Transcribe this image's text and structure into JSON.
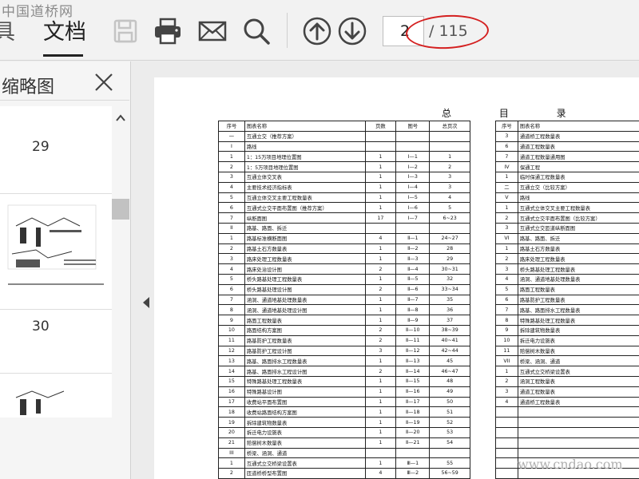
{
  "watermark_top": "中国道桥网",
  "watermark_bottom": "www.cndao.com",
  "tabs": [
    {
      "label": "具"
    },
    {
      "label": "文档"
    }
  ],
  "toolbar": {
    "icons": [
      "save-icon",
      "print-icon",
      "email-icon",
      "search-icon",
      "page-up-icon",
      "page-down-icon"
    ],
    "current_page": "2",
    "total_pages": "/ 115",
    "highlight_color": "#d42020"
  },
  "sidebar": {
    "title": "缩略图",
    "tools": [
      "delete-icon",
      "extract-icon",
      "rotate-icon"
    ],
    "thumbnails": [
      {
        "label": "29"
      },
      {
        "label": "30"
      }
    ]
  },
  "document": {
    "title": "总 目 录",
    "left_table": {
      "headers": [
        "序号",
        "图表名称",
        "页数",
        "图号",
        "总页次"
      ],
      "rows": [
        [
          "一",
          "互通立交（推荐方案）",
          "",
          "",
          ""
        ],
        [
          "I",
          "路线",
          "",
          "",
          ""
        ],
        [
          "1",
          "1：15万项目地理位置图",
          "1",
          "Ⅰ—1",
          "1"
        ],
        [
          "2",
          "1：5万项目地理位置图",
          "1",
          "Ⅰ—2",
          "2"
        ],
        [
          "3",
          "互通立体交叉表",
          "1",
          "Ⅰ—3",
          "3"
        ],
        [
          "4",
          "主要技术经济指标表",
          "1",
          "Ⅰ—4",
          "3"
        ],
        [
          "5",
          "互通立体交叉主要工程数量表",
          "1",
          "Ⅰ—5",
          "4"
        ],
        [
          "6",
          "互通式立交平面布置图（推荐方案）",
          "1",
          "Ⅰ—6",
          "5"
        ],
        [
          "7",
          "纵断面图",
          "17",
          "Ⅰ—7",
          "6~23"
        ],
        [
          "II",
          "路基、路面、拆迁",
          "",
          "",
          ""
        ],
        [
          "1",
          "路基标准横断面图",
          "4",
          "Ⅱ—1",
          "24~27"
        ],
        [
          "2",
          "路基土石方数量表",
          "1",
          "Ⅱ—2",
          "28"
        ],
        [
          "3",
          "路床处理工程数量表",
          "1",
          "Ⅱ—3",
          "29"
        ],
        [
          "4",
          "路床处治设计图",
          "2",
          "Ⅱ—4",
          "30~31"
        ],
        [
          "5",
          "桥头路基处理工程数量表",
          "1",
          "Ⅱ—5",
          "32"
        ],
        [
          "6",
          "桥头路基处理设计图",
          "2",
          "Ⅱ—6",
          "33~34"
        ],
        [
          "7",
          "涵洞、通道地基处理数量表",
          "1",
          "Ⅱ—7",
          "35"
        ],
        [
          "8",
          "涵洞、通道地基处理设计图",
          "1",
          "Ⅱ—8",
          "36"
        ],
        [
          "9",
          "路面工程数量表",
          "1",
          "Ⅱ—9",
          "37"
        ],
        [
          "10",
          "路面结构方案图",
          "2",
          "Ⅱ—10",
          "38~39"
        ],
        [
          "11",
          "路基防护工程数量表",
          "2",
          "Ⅱ—11",
          "40~41"
        ],
        [
          "12",
          "路基防护工程设计图",
          "3",
          "Ⅱ—12",
          "42~44"
        ],
        [
          "13",
          "路基、路面排水工程数量表",
          "1",
          "Ⅱ—13",
          "45"
        ],
        [
          "14",
          "路基、路面排水工程设计图",
          "2",
          "Ⅱ—14",
          "46~47"
        ],
        [
          "15",
          "特殊路基处理工程数量表",
          "1",
          "Ⅱ—15",
          "48"
        ],
        [
          "16",
          "特殊路基设计图",
          "1",
          "Ⅱ—16",
          "49"
        ],
        [
          "17",
          "收费站平面布置图",
          "1",
          "Ⅱ—17",
          "50"
        ],
        [
          "18",
          "收费站路面结构方案图",
          "1",
          "Ⅱ—18",
          "51"
        ],
        [
          "19",
          "拆除建筑物数量表",
          "1",
          "Ⅱ—19",
          "52"
        ],
        [
          "20",
          "拆迁电力设施表",
          "1",
          "Ⅱ—20",
          "53"
        ],
        [
          "21",
          "赔偿树木数量表",
          "1",
          "Ⅱ—21",
          "54"
        ],
        [
          "III",
          "桥梁、涵洞、通道",
          "",
          "",
          ""
        ],
        [
          "1",
          "互通式立交桥梁设置表",
          "1",
          "Ⅲ—1",
          "55"
        ],
        [
          "2",
          "匝道桥桥型布置图",
          "4",
          "Ⅲ—2",
          "56~59"
        ]
      ]
    },
    "right_table": {
      "headers": [
        "序号",
        "图表名称"
      ],
      "rows": [
        [
          "3",
          "通道桥工程数量表"
        ],
        [
          "6",
          "通道工程数量表"
        ],
        [
          "7",
          "通道工程数量通用图"
        ],
        [
          "IV",
          "保通工程"
        ],
        [
          "1",
          "临时保通工程数量表"
        ],
        [
          "二",
          "互通立交（比较方案）"
        ],
        [
          "V",
          "路线"
        ],
        [
          "1",
          "互通式立体交叉主要工程数量表"
        ],
        [
          "2",
          "互通式立交平面布置图（比较方案）"
        ],
        [
          "3",
          "互通式立交匝道纵断面图"
        ],
        [
          "VI",
          "路基、路面、拆迁"
        ],
        [
          "1",
          "路基土石方数量表"
        ],
        [
          "2",
          "路床处理工程数量表"
        ],
        [
          "3",
          "桥头路基处理工程数量表"
        ],
        [
          "4",
          "涵洞、通道地基处理数量表"
        ],
        [
          "5",
          "路面工程数量表"
        ],
        [
          "6",
          "路基防护工程数量表"
        ],
        [
          "7",
          "路基、路面排水工程数量表"
        ],
        [
          "8",
          "特殊路基处理工程数量表"
        ],
        [
          "9",
          "拆除建筑物数量表"
        ],
        [
          "10",
          "拆迁电力设施表"
        ],
        [
          "11",
          "赔偿树木数量表"
        ],
        [
          "VII",
          "桥梁、涵洞、通道"
        ],
        [
          "1",
          "互通式立交桥梁设置表"
        ],
        [
          "2",
          "涵洞工程数量表"
        ],
        [
          "3",
          "通道工程数量表"
        ],
        [
          "4",
          "通道桥工程数量表"
        ],
        [
          "",
          ""
        ],
        [
          "",
          ""
        ],
        [
          "",
          ""
        ],
        [
          "",
          ""
        ],
        [
          "",
          ""
        ],
        [
          "",
          ""
        ],
        [
          "",
          ""
        ]
      ]
    }
  }
}
